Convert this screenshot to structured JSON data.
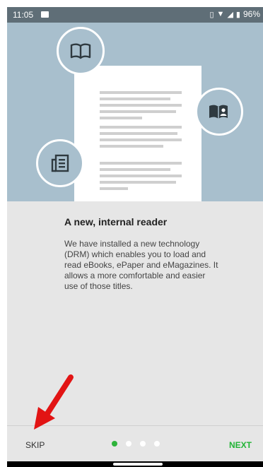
{
  "status_bar": {
    "time": "11:05",
    "battery": "96%",
    "icons": [
      "image-icon",
      "vibrate-icon",
      "wifi-icon",
      "signal-icon",
      "battery-icon"
    ]
  },
  "hero": {
    "icons": [
      "open-book-icon",
      "reader-book-icon",
      "newspaper-icon"
    ]
  },
  "content": {
    "title": "A new, internal reader",
    "description": "We have installed a new technology (DRM) which enables you to load and read eBooks, ePaper and eMagazines. It allows a more comfortable and easier use of those titles."
  },
  "footer": {
    "skip_label": "SKIP",
    "next_label": "NEXT",
    "page_count": 4,
    "active_page": 1
  },
  "colors": {
    "accent": "#2db33a",
    "hero_bg": "#a8bfcd",
    "status_bg": "#5f6e77",
    "annotation_arrow": "#e21414"
  }
}
